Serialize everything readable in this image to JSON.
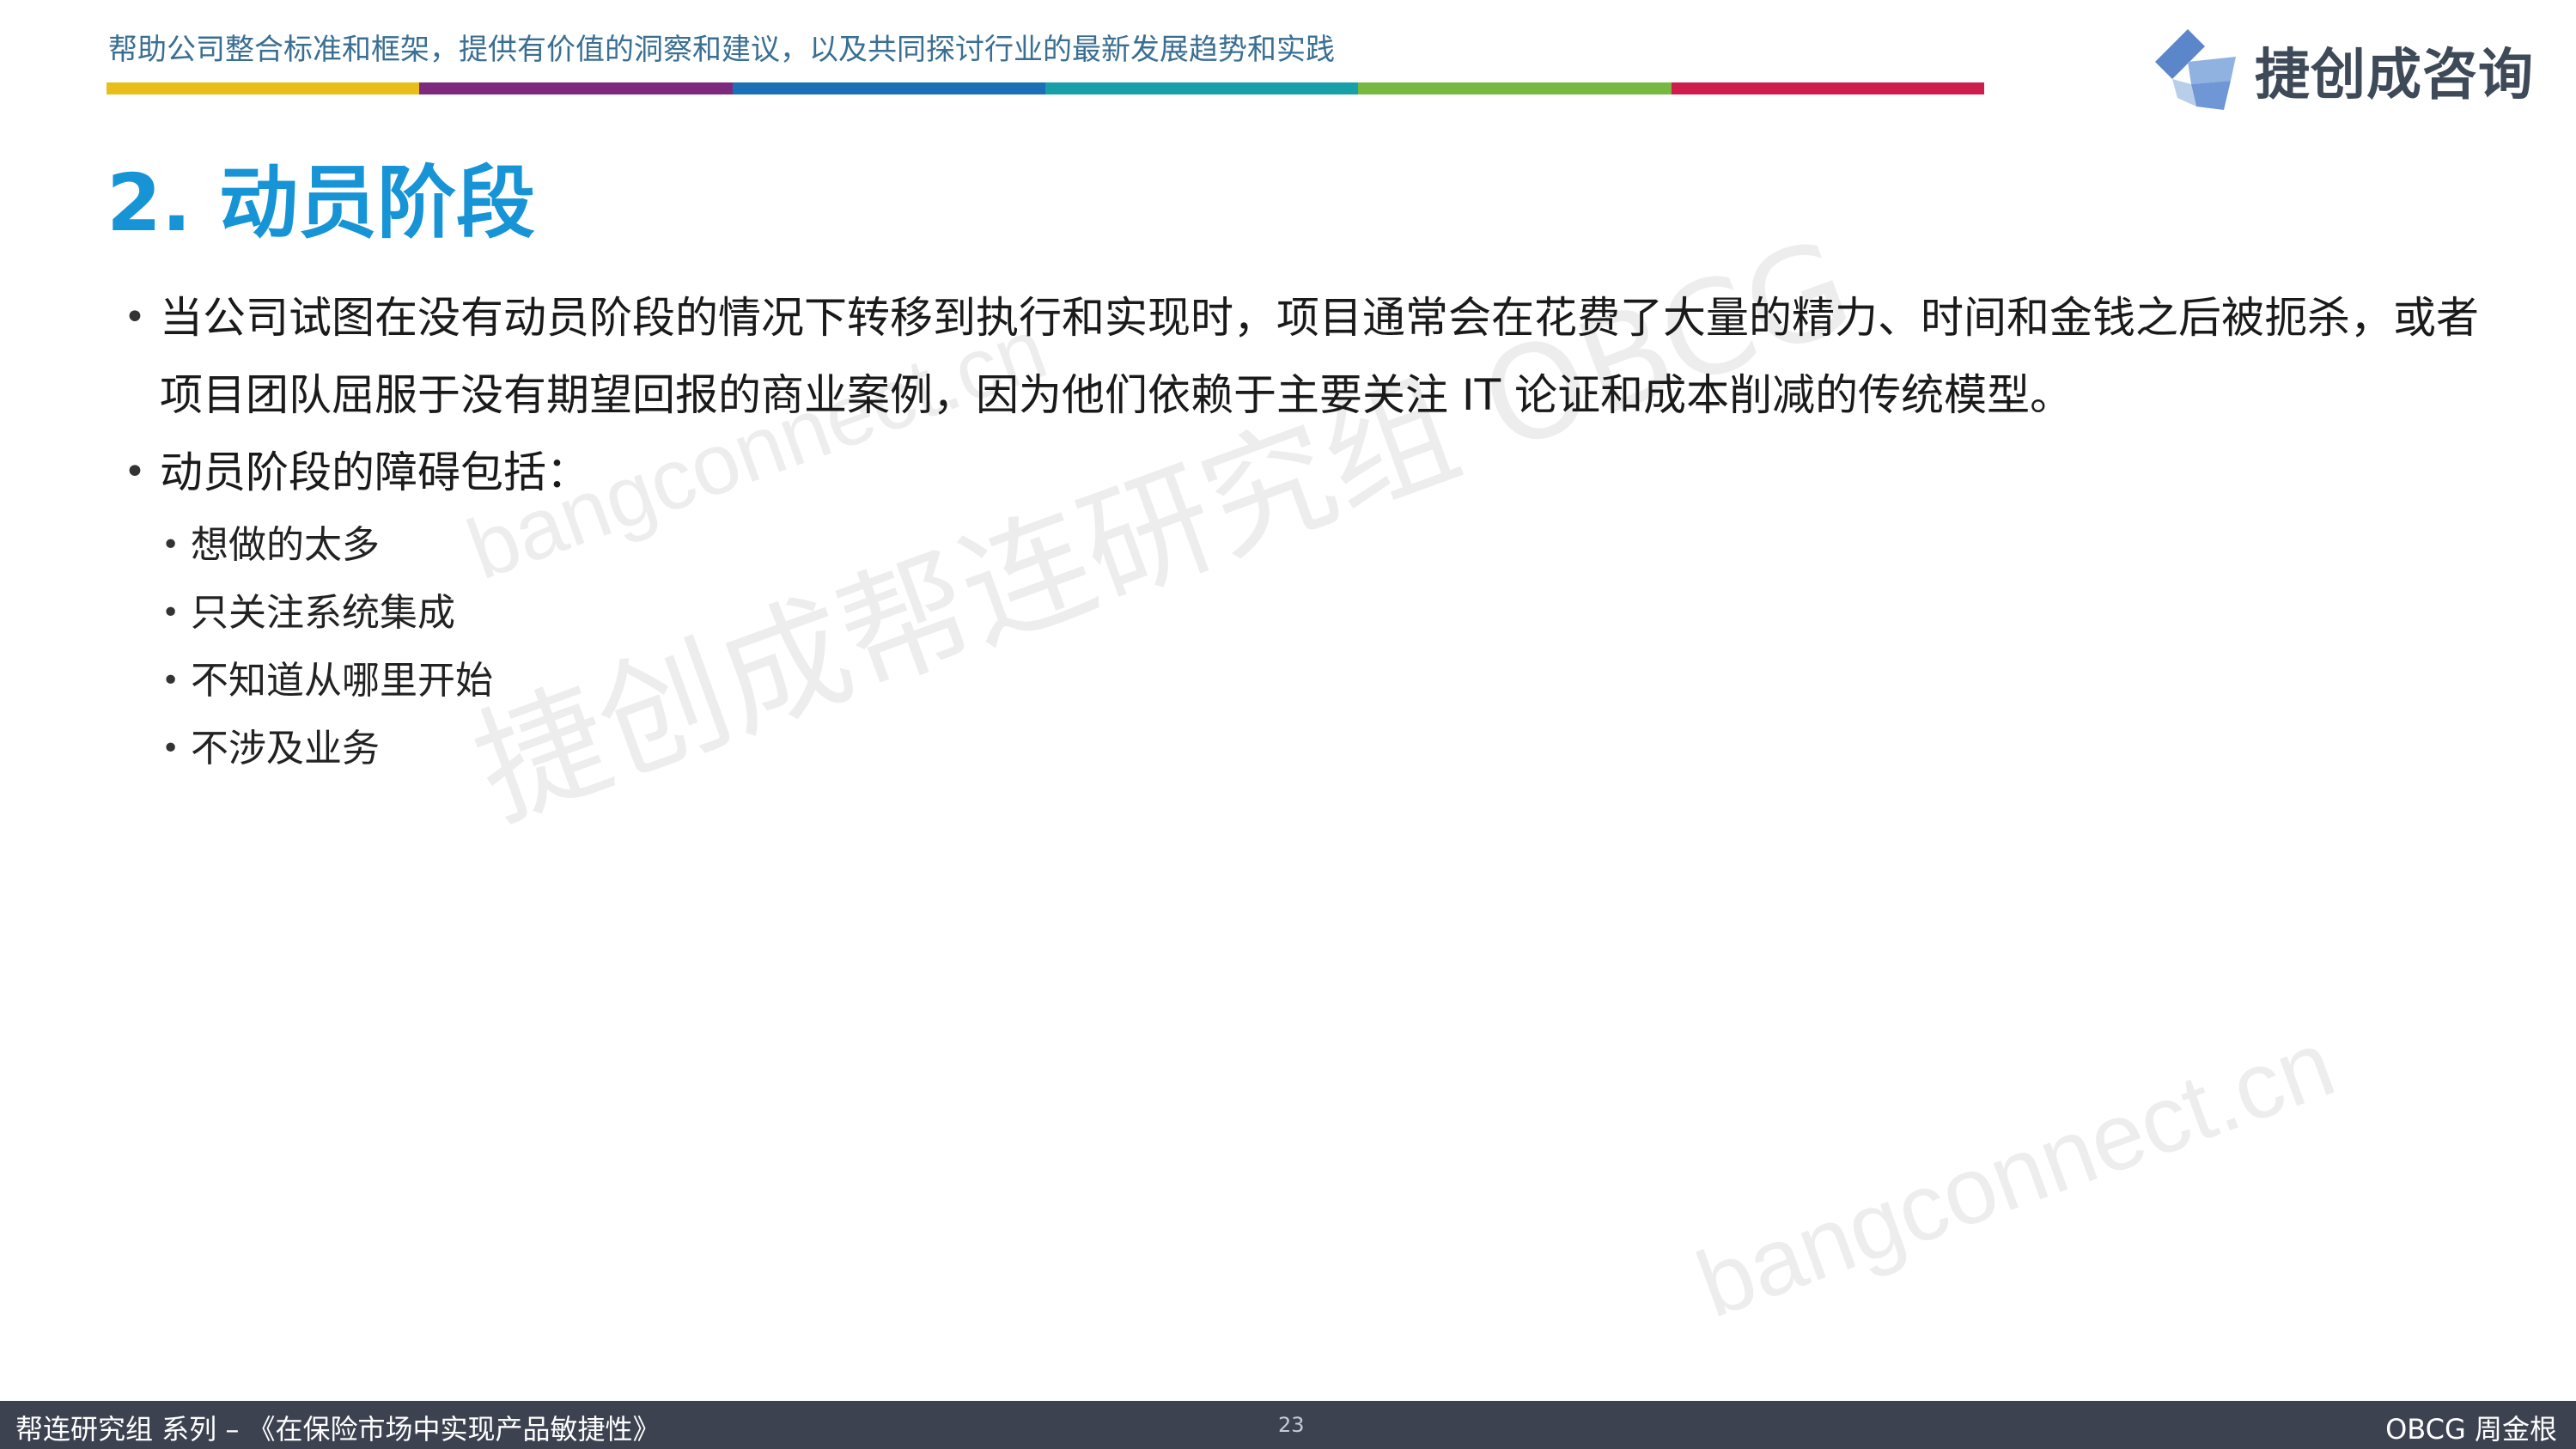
{
  "header": {
    "tagline": "帮助公司整合标准和框架，提供有价值的洞察和建议，以及共同探讨行业的最新发展趋势和实践",
    "color_bar": [
      "#e8bf1a",
      "#7d2a7e",
      "#1a6fb6",
      "#17a0a8",
      "#77b843",
      "#cc1d4b"
    ],
    "logo_text": "捷创成咨询",
    "logo_icon": "cube-icon"
  },
  "slide": {
    "title": "2. 动员阶段",
    "bullets": [
      {
        "text": "当公司试图在没有动员阶段的情况下转移到执行和实现时，项目通常会在花费了大量的精力、时间和金钱之后被扼杀，或者项目团队屈服于没有期望回报的商业案例，因为他们依赖于主要关注 IT 论证和成本削减的传统模型。"
      },
      {
        "text": "动员阶段的障碍包括：",
        "sub": [
          "想做的太多",
          "只关注系统集成",
          "不知道从哪里开始",
          "不涉及业务"
        ]
      }
    ]
  },
  "watermarks": {
    "cn": "捷创成帮连研究组 OBCG",
    "url_a": "bangconnect.cn",
    "url_b": "bangconnect.cn"
  },
  "footer": {
    "left": "帮连研究组 系列 – 《在保险市场中实现产品敏捷性》",
    "page": "23",
    "right": "OBCG 周金根"
  }
}
